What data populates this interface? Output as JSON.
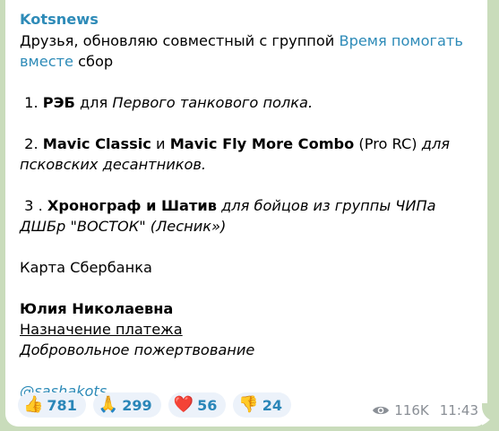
{
  "message": {
    "sender": "Kotsnews",
    "intro": {
      "before_link": "Друзья, обновляю совместный с группой ",
      "link_text": "Время помогать вместе",
      "after_link": " сбор"
    },
    "item1": {
      "num": "1. ",
      "bold": "РЭБ",
      "plain": " для ",
      "italic": "Первого танкового полка."
    },
    "item2": {
      "num": "2. ",
      "bold1": "Mavic Classic",
      "and": "  и ",
      "bold2": "Mavic Fly More Combo",
      "plain": " (Pro RC) ",
      "italic": "для псковских десантников."
    },
    "item3": {
      "num": "3 . ",
      "bold": "Хронограф и Шатив",
      "italic": " для бойцов из группы ЧИПа  ДШБр \"ВОСТОК\" (Лесник»)"
    },
    "card": "Карта Сбербанка",
    "recipient": "Юлия Николаевна",
    "purpose_label": "Назначение платежа",
    "purpose_value": "Добровольное пожертвование",
    "mention": "@sashakots"
  },
  "reactions": [
    {
      "emoji": "👍",
      "count": "781"
    },
    {
      "emoji": "🙏",
      "count": "299"
    },
    {
      "emoji": "❤️",
      "count": "56"
    },
    {
      "emoji": "👎",
      "count": "24"
    }
  ],
  "footer": {
    "views": "116K",
    "time": "11:43",
    "views_icon": "eye-icon"
  },
  "colors": {
    "accent": "#2e8bb8",
    "background": "#c9dcbb",
    "bubble": "#ffffff",
    "reaction_bg": "#ecf2fa",
    "meta": "#8a8f96"
  }
}
